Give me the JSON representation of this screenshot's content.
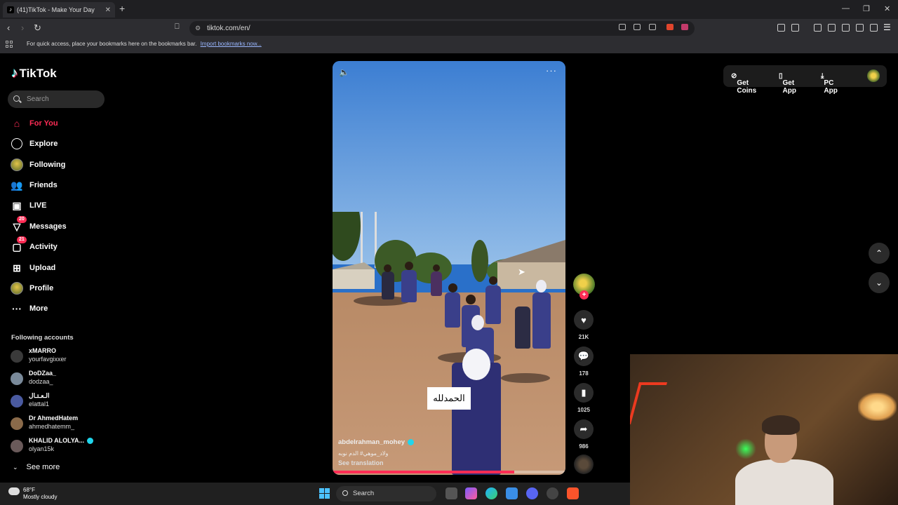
{
  "browser": {
    "tab_title": "(41)TikTok - Make Your Day",
    "url": "tiktok.com/en/",
    "bookmarks_hint": "For quick access, place your bookmarks here on the bookmarks bar.",
    "import_link": "Import bookmarks now..."
  },
  "sidebar": {
    "brand": "TikTok",
    "search_placeholder": "Search",
    "nav": [
      {
        "label": "For You",
        "icon": "home-icon"
      },
      {
        "label": "Explore",
        "icon": "compass-icon"
      },
      {
        "label": "Following",
        "icon": "following-avatar"
      },
      {
        "label": "Friends",
        "icon": "friends-icon"
      },
      {
        "label": "LIVE",
        "icon": "live-icon"
      },
      {
        "label": "Messages",
        "icon": "messages-icon",
        "badge": "20"
      },
      {
        "label": "Activity",
        "icon": "activity-icon",
        "badge": "21"
      },
      {
        "label": "Upload",
        "icon": "upload-icon"
      },
      {
        "label": "Profile",
        "icon": "profile-avatar"
      },
      {
        "label": "More",
        "icon": "more-icon"
      }
    ],
    "following_title": "Following accounts",
    "accounts": [
      {
        "name": "xMARRO",
        "user": "yourfavgixxer"
      },
      {
        "name": "DoDZaa_",
        "user": "dodzaa_"
      },
      {
        "name": "الـعـتـال",
        "user": "elattal1"
      },
      {
        "name": "Dr AhmedHatem",
        "user": "ahmedhatemm_"
      },
      {
        "name": "KHALID ALOLYA...",
        "user": "olyan15k",
        "verified": true
      }
    ],
    "see_more": "See more"
  },
  "video": {
    "caption_overlay": "الحمدلله",
    "author": "abdelrahman_mohey",
    "description": "ولاد_موهي# الدم نوبه",
    "see_translation": "See translation",
    "progress": 0.78
  },
  "actions": {
    "likes": "21K",
    "comments": "178",
    "saves": "1025",
    "shares": "986"
  },
  "header": {
    "get_coins": "Get Coins",
    "get_app": "Get App",
    "pc_app": "PC App"
  },
  "taskbar": {
    "temp": "68°F",
    "condition": "Mostly cloudy",
    "search": "Search"
  },
  "colors": {
    "accent": "#fe2c55",
    "background": "#000000",
    "chrome": "#2d2d31"
  }
}
